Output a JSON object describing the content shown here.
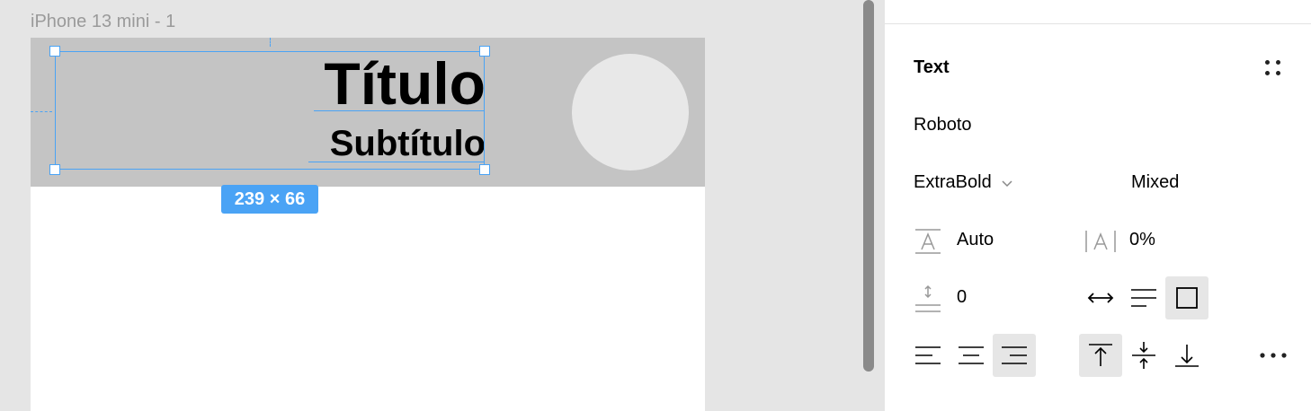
{
  "canvas": {
    "frame_label": "iPhone 13 mini - 1",
    "title_text": "Título",
    "subtitle_text": "Subtítulo",
    "selection_size": "239 × 66",
    "selection_color": "#4aa3f5"
  },
  "panel": {
    "section_title": "Text",
    "font_family": "Roboto",
    "font_weight": "ExtraBold",
    "font_size": "Mixed",
    "line_height": "Auto",
    "letter_spacing": "0%",
    "paragraph_spacing": "0",
    "resizing": {
      "auto_width_icon": "arrows-horizontal-icon",
      "auto_height_icon": "lines-icon",
      "fixed_size_icon": "square-icon",
      "active": "fixed_size"
    },
    "horizontal_align": {
      "active": "right"
    },
    "vertical_align": {
      "active": "top"
    }
  }
}
